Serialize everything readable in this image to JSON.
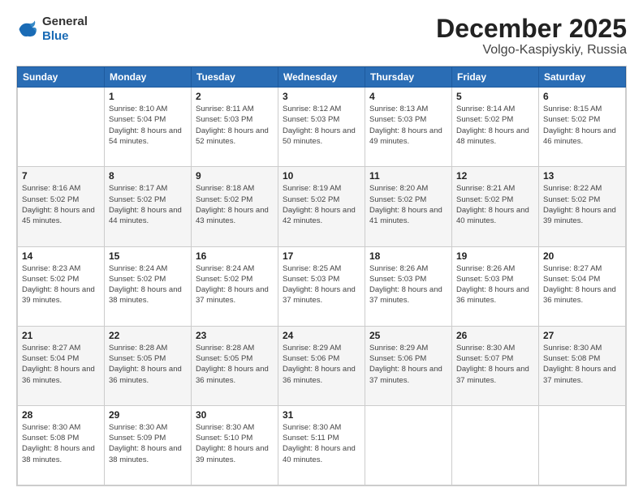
{
  "header": {
    "logo_general": "General",
    "logo_blue": "Blue",
    "month": "December 2025",
    "location": "Volgo-Kaspiyskiy, Russia"
  },
  "weekdays": [
    "Sunday",
    "Monday",
    "Tuesday",
    "Wednesday",
    "Thursday",
    "Friday",
    "Saturday"
  ],
  "weeks": [
    [
      {
        "day": "",
        "sunrise": "",
        "sunset": "",
        "daylight": ""
      },
      {
        "day": "1",
        "sunrise": "Sunrise: 8:10 AM",
        "sunset": "Sunset: 5:04 PM",
        "daylight": "Daylight: 8 hours and 54 minutes."
      },
      {
        "day": "2",
        "sunrise": "Sunrise: 8:11 AM",
        "sunset": "Sunset: 5:03 PM",
        "daylight": "Daylight: 8 hours and 52 minutes."
      },
      {
        "day": "3",
        "sunrise": "Sunrise: 8:12 AM",
        "sunset": "Sunset: 5:03 PM",
        "daylight": "Daylight: 8 hours and 50 minutes."
      },
      {
        "day": "4",
        "sunrise": "Sunrise: 8:13 AM",
        "sunset": "Sunset: 5:03 PM",
        "daylight": "Daylight: 8 hours and 49 minutes."
      },
      {
        "day": "5",
        "sunrise": "Sunrise: 8:14 AM",
        "sunset": "Sunset: 5:02 PM",
        "daylight": "Daylight: 8 hours and 48 minutes."
      },
      {
        "day": "6",
        "sunrise": "Sunrise: 8:15 AM",
        "sunset": "Sunset: 5:02 PM",
        "daylight": "Daylight: 8 hours and 46 minutes."
      }
    ],
    [
      {
        "day": "7",
        "sunrise": "Sunrise: 8:16 AM",
        "sunset": "Sunset: 5:02 PM",
        "daylight": "Daylight: 8 hours and 45 minutes."
      },
      {
        "day": "8",
        "sunrise": "Sunrise: 8:17 AM",
        "sunset": "Sunset: 5:02 PM",
        "daylight": "Daylight: 8 hours and 44 minutes."
      },
      {
        "day": "9",
        "sunrise": "Sunrise: 8:18 AM",
        "sunset": "Sunset: 5:02 PM",
        "daylight": "Daylight: 8 hours and 43 minutes."
      },
      {
        "day": "10",
        "sunrise": "Sunrise: 8:19 AM",
        "sunset": "Sunset: 5:02 PM",
        "daylight": "Daylight: 8 hours and 42 minutes."
      },
      {
        "day": "11",
        "sunrise": "Sunrise: 8:20 AM",
        "sunset": "Sunset: 5:02 PM",
        "daylight": "Daylight: 8 hours and 41 minutes."
      },
      {
        "day": "12",
        "sunrise": "Sunrise: 8:21 AM",
        "sunset": "Sunset: 5:02 PM",
        "daylight": "Daylight: 8 hours and 40 minutes."
      },
      {
        "day": "13",
        "sunrise": "Sunrise: 8:22 AM",
        "sunset": "Sunset: 5:02 PM",
        "daylight": "Daylight: 8 hours and 39 minutes."
      }
    ],
    [
      {
        "day": "14",
        "sunrise": "Sunrise: 8:23 AM",
        "sunset": "Sunset: 5:02 PM",
        "daylight": "Daylight: 8 hours and 39 minutes."
      },
      {
        "day": "15",
        "sunrise": "Sunrise: 8:24 AM",
        "sunset": "Sunset: 5:02 PM",
        "daylight": "Daylight: 8 hours and 38 minutes."
      },
      {
        "day": "16",
        "sunrise": "Sunrise: 8:24 AM",
        "sunset": "Sunset: 5:02 PM",
        "daylight": "Daylight: 8 hours and 37 minutes."
      },
      {
        "day": "17",
        "sunrise": "Sunrise: 8:25 AM",
        "sunset": "Sunset: 5:03 PM",
        "daylight": "Daylight: 8 hours and 37 minutes."
      },
      {
        "day": "18",
        "sunrise": "Sunrise: 8:26 AM",
        "sunset": "Sunset: 5:03 PM",
        "daylight": "Daylight: 8 hours and 37 minutes."
      },
      {
        "day": "19",
        "sunrise": "Sunrise: 8:26 AM",
        "sunset": "Sunset: 5:03 PM",
        "daylight": "Daylight: 8 hours and 36 minutes."
      },
      {
        "day": "20",
        "sunrise": "Sunrise: 8:27 AM",
        "sunset": "Sunset: 5:04 PM",
        "daylight": "Daylight: 8 hours and 36 minutes."
      }
    ],
    [
      {
        "day": "21",
        "sunrise": "Sunrise: 8:27 AM",
        "sunset": "Sunset: 5:04 PM",
        "daylight": "Daylight: 8 hours and 36 minutes."
      },
      {
        "day": "22",
        "sunrise": "Sunrise: 8:28 AM",
        "sunset": "Sunset: 5:05 PM",
        "daylight": "Daylight: 8 hours and 36 minutes."
      },
      {
        "day": "23",
        "sunrise": "Sunrise: 8:28 AM",
        "sunset": "Sunset: 5:05 PM",
        "daylight": "Daylight: 8 hours and 36 minutes."
      },
      {
        "day": "24",
        "sunrise": "Sunrise: 8:29 AM",
        "sunset": "Sunset: 5:06 PM",
        "daylight": "Daylight: 8 hours and 36 minutes."
      },
      {
        "day": "25",
        "sunrise": "Sunrise: 8:29 AM",
        "sunset": "Sunset: 5:06 PM",
        "daylight": "Daylight: 8 hours and 37 minutes."
      },
      {
        "day": "26",
        "sunrise": "Sunrise: 8:30 AM",
        "sunset": "Sunset: 5:07 PM",
        "daylight": "Daylight: 8 hours and 37 minutes."
      },
      {
        "day": "27",
        "sunrise": "Sunrise: 8:30 AM",
        "sunset": "Sunset: 5:08 PM",
        "daylight": "Daylight: 8 hours and 37 minutes."
      }
    ],
    [
      {
        "day": "28",
        "sunrise": "Sunrise: 8:30 AM",
        "sunset": "Sunset: 5:08 PM",
        "daylight": "Daylight: 8 hours and 38 minutes."
      },
      {
        "day": "29",
        "sunrise": "Sunrise: 8:30 AM",
        "sunset": "Sunset: 5:09 PM",
        "daylight": "Daylight: 8 hours and 38 minutes."
      },
      {
        "day": "30",
        "sunrise": "Sunrise: 8:30 AM",
        "sunset": "Sunset: 5:10 PM",
        "daylight": "Daylight: 8 hours and 39 minutes."
      },
      {
        "day": "31",
        "sunrise": "Sunrise: 8:30 AM",
        "sunset": "Sunset: 5:11 PM",
        "daylight": "Daylight: 8 hours and 40 minutes."
      },
      {
        "day": "",
        "sunrise": "",
        "sunset": "",
        "daylight": ""
      },
      {
        "day": "",
        "sunrise": "",
        "sunset": "",
        "daylight": ""
      },
      {
        "day": "",
        "sunrise": "",
        "sunset": "",
        "daylight": ""
      }
    ]
  ]
}
